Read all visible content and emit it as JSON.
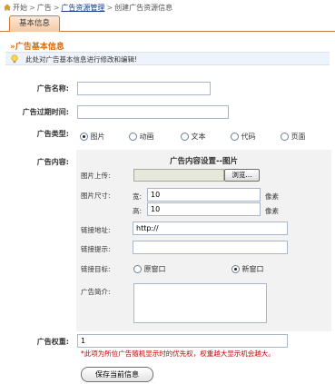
{
  "breadcrumb": {
    "home": "开始",
    "sep1": ">",
    "item1": "广告",
    "sep2": ">",
    "item2": "广告资源管理",
    "sep3": ">",
    "item3": "创建广告资源信息"
  },
  "tab": {
    "label": "基本信息"
  },
  "section": {
    "title": "»广告基本信息",
    "notice": "此处对广告基本信息进行修改和编辑!"
  },
  "form": {
    "name_label": "广告名称:",
    "name_value": "",
    "expire_label": "广告过期时间:",
    "expire_value": "",
    "type_label": "广告类型:",
    "type_options": [
      "图片",
      "动画",
      "文本",
      "代码",
      "页面"
    ],
    "type_selected": "图片",
    "content_label": "广告内容:",
    "weight_label": "广告权重:",
    "weight_value": "1",
    "weight_note": "*此项为所位广告随机显示时的优先权，权重越大显示机会越大。",
    "save_label": "保存当前信息"
  },
  "content_panel": {
    "title": "广告内容设置--图片",
    "upload_label": "图片上传:",
    "browse_label": "浏览...",
    "size_label": "图片尺寸:",
    "width_label": "宽:",
    "width_value": "10",
    "width_unit": "像素",
    "height_label": "高:",
    "height_value": "10",
    "height_unit": "像素",
    "link_label": "链接地址:",
    "link_value": "http://",
    "tip_label": "链接提示:",
    "tip_value": "",
    "target_label": "链接目标:",
    "target_options": [
      "原窗口",
      "新窗口"
    ],
    "target_selected": "新窗口",
    "desc_label": "广告简介:",
    "desc_value": ""
  },
  "colors": {
    "accent_orange": "#d06f1c",
    "link_blue": "#1a3d8f",
    "note_red": "#c00000",
    "panel_bg": "#f2f2f2"
  },
  "icons": [
    "home-icon",
    "lightbulb-icon"
  ]
}
